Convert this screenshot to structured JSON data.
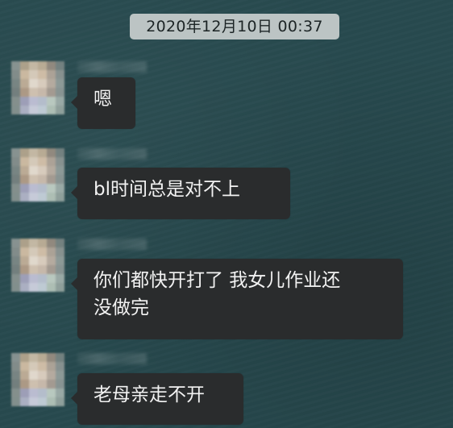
{
  "timestamp": "2020年12月10日 00:37",
  "messages": [
    {
      "text": "嗯"
    },
    {
      "text": "bl时间总是对不上"
    },
    {
      "text": "你们都快开打了 我女儿作业还\n没做完"
    },
    {
      "text": "老母亲走不开"
    }
  ]
}
